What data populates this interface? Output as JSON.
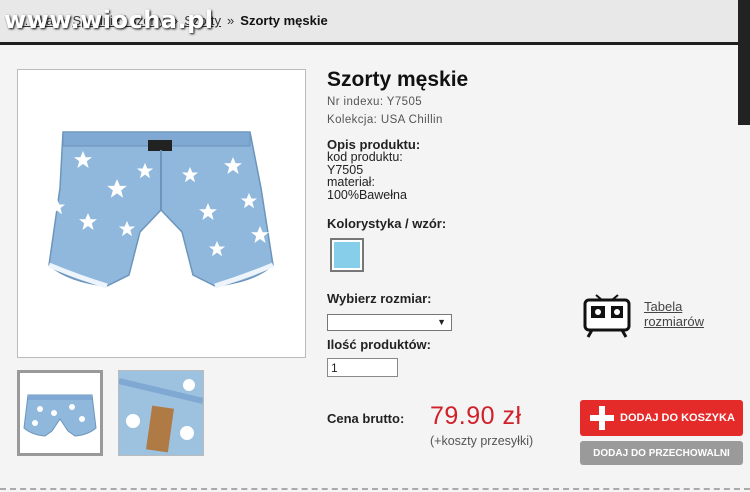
{
  "watermark": "www.wiocha.pl",
  "breadcrumb": {
    "items": [
      "…ska",
      "Spodnie i szorty",
      "Szorty"
    ],
    "current": "Szorty męskie",
    "separator": "»"
  },
  "product": {
    "title": "Szorty męskie",
    "index_line": "Nr indexu: Y7505",
    "collection_line": "Kolekcja: USA Chillin",
    "description_heading": "Opis produktu:",
    "description_lines": [
      "kod produktu:",
      "Y7505",
      "materiał:",
      "100%Bawełna"
    ],
    "color_heading": "Kolorystyka / wzór:",
    "swatch_color": "#87ceeb",
    "size_heading": "Wybierz rozmiar:",
    "size_selected": "",
    "quantity_heading": "Ilość produktów:",
    "quantity_value": "1",
    "size_chart_label_1": "Tabela",
    "size_chart_label_2": "rozmiarów",
    "price_label": "Cena brutto:",
    "price": "79.90 zł",
    "shipping_note": "(+koszty przesyłki)"
  },
  "buttons": {
    "add_to_cart": "DODAJ DO KOSZYKA",
    "add_to_storage": "DODAJ DO PRZECHOWALNI"
  },
  "colors": {
    "accent_red": "#e52a2a",
    "price_red": "#d0202a",
    "denim": "#8fb8dc"
  },
  "icons": {
    "cart_button": "plus-icon",
    "size_chart": "size-chart-icon",
    "select": "chevron-down-icon"
  }
}
